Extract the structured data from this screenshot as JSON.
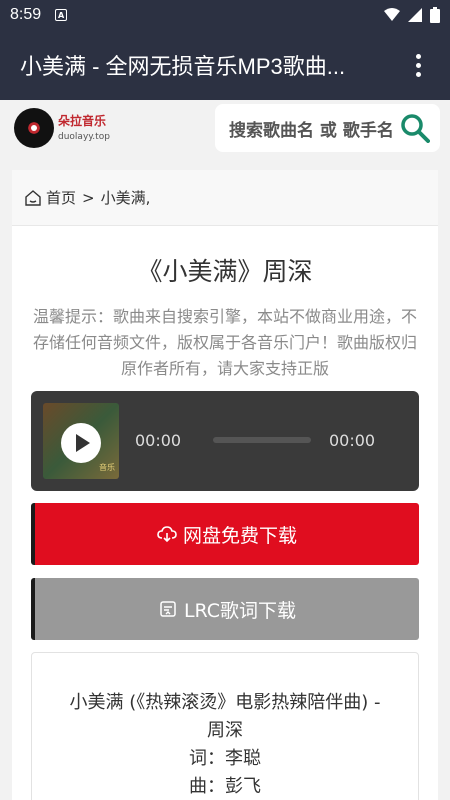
{
  "status_bar": {
    "time": "8:59",
    "notification_icon": "A"
  },
  "app_bar": {
    "title": "小美满 - 全网无损音乐MP3歌曲..."
  },
  "site": {
    "logo_name": "朵拉音乐",
    "logo_url": "duolayy.top",
    "search_placeholder": "搜索歌曲名 或 歌手名"
  },
  "breadcrumb": {
    "home": "首页",
    "separator": ">",
    "current": "小美满,"
  },
  "song": {
    "title": "《小美满》周深",
    "notice": "温馨提示：歌曲来自搜索引擎，本站不做商业用途，不存储任何音频文件，版权属于各音乐门户！歌曲版权归原作者所有，请大家支持正版"
  },
  "player": {
    "current_time": "00:00",
    "total_time": "00:00",
    "cover_label": "音乐",
    "progress": 0
  },
  "buttons": {
    "download": "网盘免费下载",
    "lrc": "LRC歌词下载"
  },
  "lyrics": {
    "line1": "小美满 (《热辣滚烫》电影热辣陪伴曲) -",
    "line2": "周深",
    "line3": "词：李聪",
    "line4": "曲：彭飞"
  },
  "colors": {
    "appbar": "#2c3142",
    "download": "#e00d1f",
    "lrc": "#999999",
    "search_icon": "#1a8a6a"
  }
}
